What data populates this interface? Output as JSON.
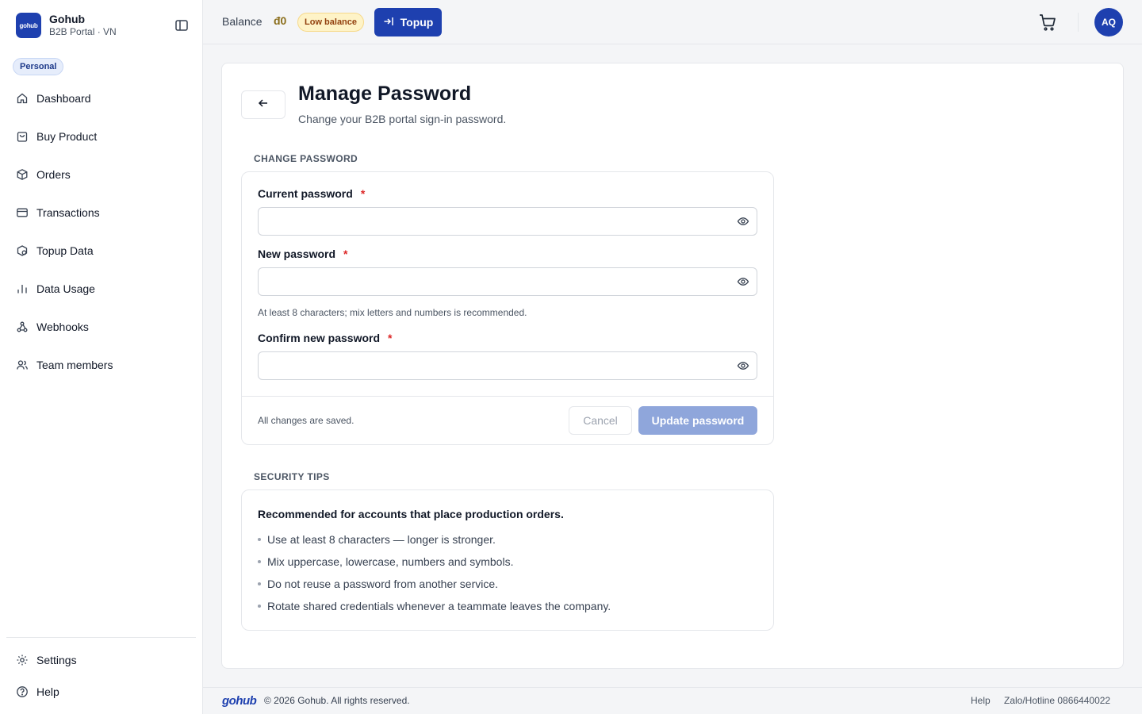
{
  "brand": {
    "logo_text": "gohub",
    "name": "Gohub",
    "subtitle": "B2B Portal · VN"
  },
  "sidebar": {
    "badge": "Personal",
    "items": [
      {
        "label": "Dashboard",
        "icon": "home-icon"
      },
      {
        "label": "Buy Product",
        "icon": "shopping-bag-icon"
      },
      {
        "label": "Orders",
        "icon": "package-icon"
      },
      {
        "label": "Transactions",
        "icon": "credit-card-icon"
      },
      {
        "label": "Topup Data",
        "icon": "topup-data-icon"
      },
      {
        "label": "Data Usage",
        "icon": "bar-chart-icon"
      },
      {
        "label": "Webhooks",
        "icon": "webhook-icon"
      },
      {
        "label": "Team members",
        "icon": "users-icon"
      }
    ],
    "bottom_items": [
      {
        "label": "Settings",
        "icon": "gear-icon"
      },
      {
        "label": "Help",
        "icon": "help-circle-icon"
      }
    ]
  },
  "header": {
    "balance_label": "Balance",
    "balance_value": "đ0",
    "low_balance_badge": "Low balance",
    "topup_label": "Topup",
    "avatar_initials": "AQ"
  },
  "page": {
    "title": "Manage Password",
    "subtitle": "Change your B2B portal sign-in password."
  },
  "change_password": {
    "section_label": "CHANGE PASSWORD",
    "fields": [
      {
        "label": "Current password",
        "required_mark": "*",
        "value": ""
      },
      {
        "label": "New password",
        "required_mark": "*",
        "value": ""
      },
      {
        "label": "Confirm new password",
        "required_mark": "*",
        "value": ""
      }
    ],
    "hint": "At least 8 characters; mix letters and numbers is recommended.",
    "status": "All changes are saved.",
    "cancel_label": "Cancel",
    "update_label": "Update password"
  },
  "security_tips": {
    "section_label": "SECURITY TIPS",
    "title": "Recommended for accounts that place production orders.",
    "tips": [
      "Use at least 8 characters — longer is stronger.",
      "Mix uppercase, lowercase, numbers and symbols.",
      "Do not reuse a password from another service.",
      "Rotate shared credentials whenever a teammate leaves the company."
    ]
  },
  "footer": {
    "logo": "gohub",
    "copyright": "© 2026 Gohub. All rights reserved.",
    "help": "Help",
    "hotline": "Zalo/Hotline 0866440022"
  },
  "colors": {
    "primary": "#1e40af",
    "primary_disabled": "#8fa6db",
    "warning_bg": "#fef3c7",
    "required": "#dc2626"
  }
}
